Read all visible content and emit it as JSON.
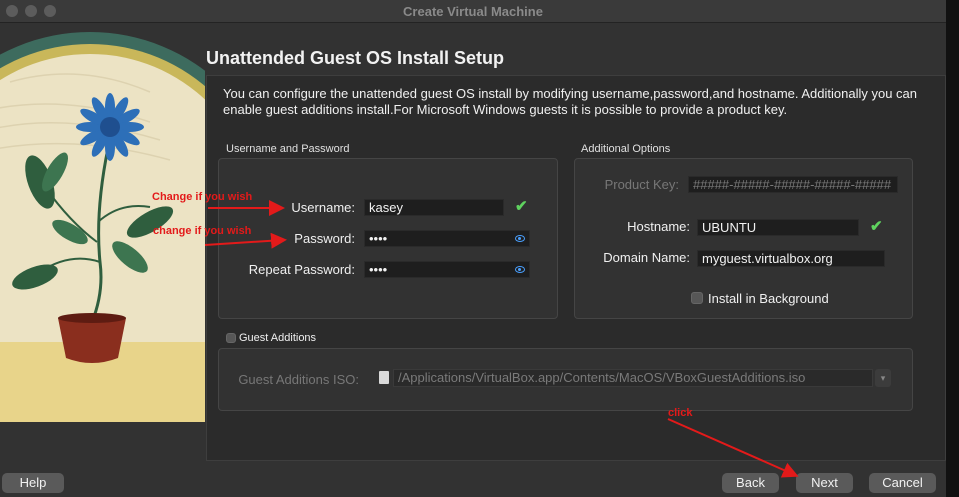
{
  "window": {
    "title": "Create Virtual Machine"
  },
  "page": {
    "heading": "Unattended Guest OS Install Setup",
    "description": "You can configure the unattended guest OS install by modifying username,password,and hostname. Additionally you can enable guest additions install.For Microsoft Windows guests it is possible to provide a product key."
  },
  "credentials": {
    "group_label": "Username and Password",
    "username_label": "Username:",
    "username_value": "kasey",
    "password_label": "Password:",
    "password_value": "••••",
    "repeat_label": "Repeat Password:",
    "repeat_value": "••••"
  },
  "additional": {
    "group_label": "Additional Options",
    "product_key_label": "Product Key:",
    "product_key_value": "#####-#####-#####-#####-#####",
    "hostname_label": "Hostname:",
    "hostname_value": "UBUNTU",
    "domain_label": "Domain Name:",
    "domain_value": "myguest.virtualbox.org",
    "install_bg_label": "Install in Background",
    "install_bg_checked": false
  },
  "guest_additions": {
    "label": "Guest Additions",
    "checked": false,
    "iso_label": "Guest Additions ISO:",
    "iso_value": "/Applications/VirtualBox.app/Contents/MacOS/VBoxGuestAdditions.iso"
  },
  "buttons": {
    "help": "Help",
    "back": "Back",
    "next": "Next",
    "cancel": "Cancel"
  },
  "annotations": {
    "username_note": "Change if you wish",
    "password_note": "change if you wish",
    "click_note": "click",
    "color": "#e31a1a"
  },
  "icons": {
    "valid": "checkmark-icon",
    "reveal": "eye-icon",
    "file": "document-icon",
    "dropdown": "chevron-down-icon"
  }
}
